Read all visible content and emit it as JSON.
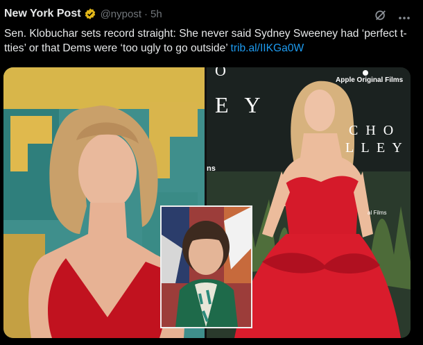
{
  "tweet": {
    "author_name": "New York Post",
    "handle": "@nypost",
    "separator": "·",
    "time": "5h",
    "text": "Sen. Klobuchar sets record straight: She never said Sydney Sweeney had ‘perfect t-tties’ or that Dems were ‘too ugly to go outside’",
    "link": "trib.al/IIKGa0W"
  },
  "media": {
    "right_panel_text": {
      "apple_label": "Apple Original Films",
      "letters_top": "O",
      "letters_ey": "E Y",
      "letters_cho": "C H O",
      "letters_lley": "L L E Y",
      "films_small": "al Films",
      "ns_text": "ns"
    }
  },
  "icons": {
    "verified": "verified-badge-icon",
    "grok": "grok-icon",
    "more": "more-icon"
  },
  "colors": {
    "background": "#000000",
    "link": "#1d9bf0",
    "muted": "#71767b",
    "badge": "#e2b719"
  }
}
